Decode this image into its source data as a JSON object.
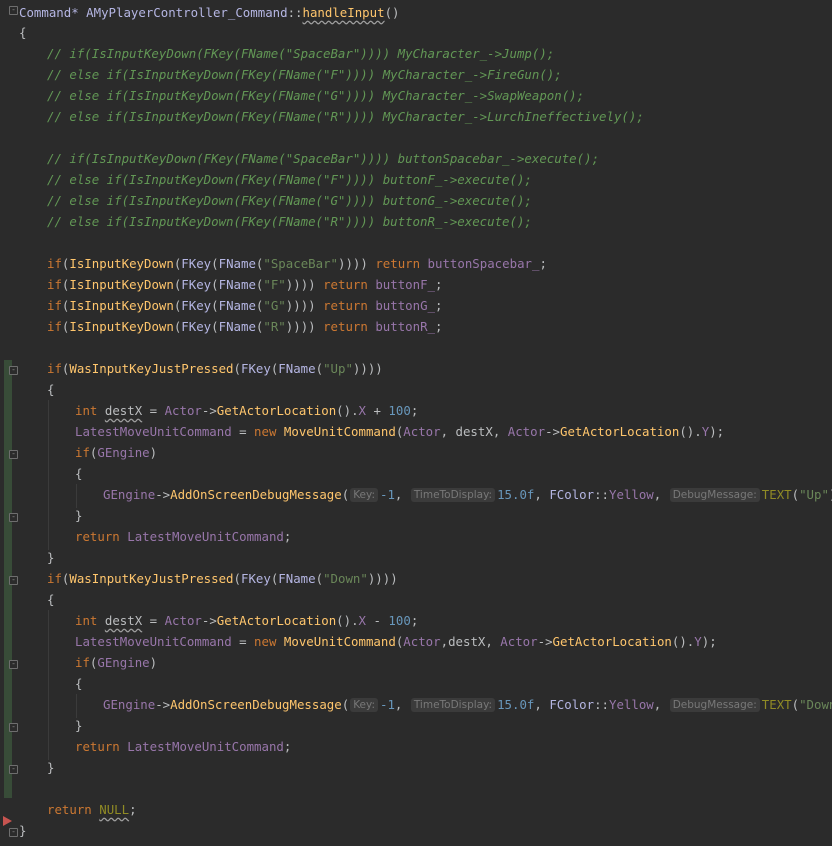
{
  "code": {
    "signature_type": "Command*",
    "signature_class": "AMyPlayerController_Command",
    "signature_scope": "::",
    "signature_method": "handleInput",
    "signature_parens": "()",
    "open_brace": "{",
    "close_brace": "}",
    "comments_group1": [
      "// if(IsInputKeyDown(FKey(FName(\"SpaceBar\")))) MyCharacter_->Jump();",
      "// else if(IsInputKeyDown(FKey(FName(\"F\")))) MyCharacter_->FireGun();",
      "// else if(IsInputKeyDown(FKey(FName(\"G\")))) MyCharacter_->SwapWeapon();",
      "// else if(IsInputKeyDown(FKey(FName(\"R\")))) MyCharacter_->LurchIneffectively();"
    ],
    "comments_group2": [
      "// if(IsInputKeyDown(FKey(FName(\"SpaceBar\")))) buttonSpacebar_->execute();",
      "// else if(IsInputKeyDown(FKey(FName(\"F\")))) buttonF_->execute();",
      "// else if(IsInputKeyDown(FKey(FName(\"G\")))) buttonG_->execute();",
      "// else if(IsInputKeyDown(FKey(FName(\"R\")))) buttonR_->execute();"
    ],
    "key_checks": [
      {
        "key": "\"SpaceBar\"",
        "button": "buttonSpacebar_"
      },
      {
        "key": "\"F\"",
        "button": "buttonF_"
      },
      {
        "key": "\"G\"",
        "button": "buttonG_"
      },
      {
        "key": "\"R\"",
        "button": "buttonR_"
      }
    ],
    "blocks": [
      {
        "key": "\"Up\"",
        "op": "+",
        "sep": ", ",
        "debug_text": "\"Up\""
      },
      {
        "key": "\"Down\"",
        "op": "-",
        "sep": ",",
        "debug_text": "\"Down\""
      }
    ],
    "tokens": {
      "if": "if",
      "int": "int",
      "new": "new",
      "return": "return",
      "IsInputKeyDown": "IsInputKeyDown",
      "WasInputKeyJustPressed": "WasInputKeyJustPressed",
      "FKey": "FKey",
      "FName": "FName",
      "destX": "destX",
      "Actor": "Actor",
      "GetActorLocation": "GetActorLocation",
      "X": "X",
      "Y": "Y",
      "num_100": "100",
      "LatestMoveUnitCommand": "LatestMoveUnitCommand",
      "MoveUnitCommand": "MoveUnitCommand",
      "GEngine": "GEngine",
      "AddOnScreenDebugMessage": "AddOnScreenDebugMessage",
      "hint_key": "Key:",
      "num_m1": "-1",
      "hint_time": "TimeToDisplay:",
      "num_15": "15.0f",
      "FColor": "FColor",
      "Yellow": "Yellow",
      "hint_msg": "DebugMessage:",
      "TEXT": "TEXT",
      "NULL": "NULL"
    }
  },
  "colors": {
    "background": "#2b2b2b",
    "comment": "#629755",
    "keyword": "#cc7832",
    "function": "#ffc66d",
    "string": "#6a8759",
    "number": "#6897bb",
    "field": "#9876aa",
    "macro": "#908b25",
    "change_bar": "#384c38",
    "breakpoint_arrow": "#c75450"
  }
}
